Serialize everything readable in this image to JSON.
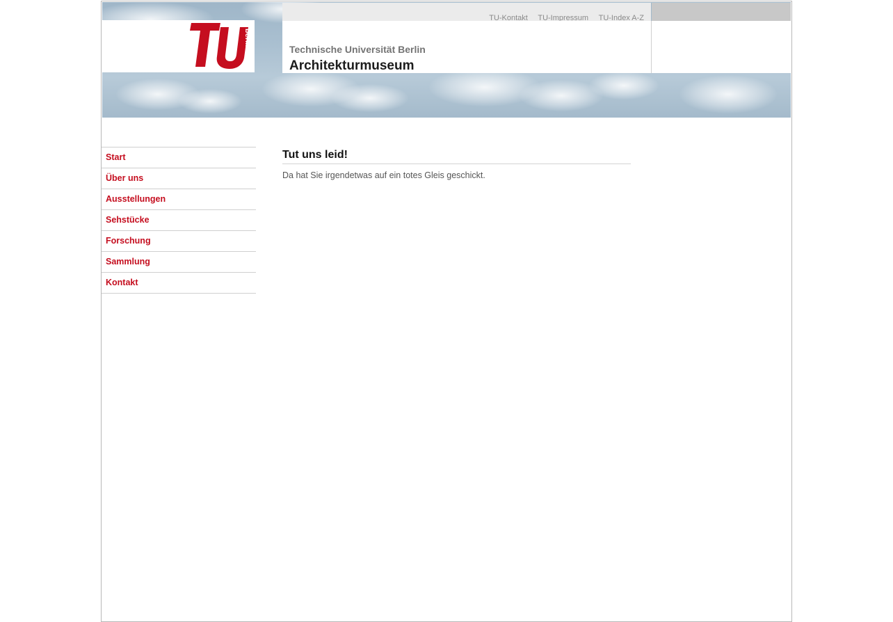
{
  "header": {
    "top_links": [
      {
        "label": "TU-Kontakt"
      },
      {
        "label": "TU-Impressum"
      },
      {
        "label": "TU-Index A-Z"
      }
    ],
    "university_name": "Technische Universität Berlin",
    "site_name": "Architekturmuseum",
    "logo": {
      "icon": "tu-berlin-logo",
      "text": "berlin",
      "color": "#c50e1f"
    }
  },
  "nav": {
    "items": [
      {
        "label": "Start"
      },
      {
        "label": "Über uns"
      },
      {
        "label": "Ausstellungen"
      },
      {
        "label": "Sehstücke"
      },
      {
        "label": "Forschung"
      },
      {
        "label": "Sammlung"
      },
      {
        "label": "Kontakt"
      }
    ],
    "link_color": "#c50e1f"
  },
  "content": {
    "title": "Tut uns leid!",
    "text": "Da hat Sie irgendetwas auf ein totes Gleis geschickt."
  }
}
